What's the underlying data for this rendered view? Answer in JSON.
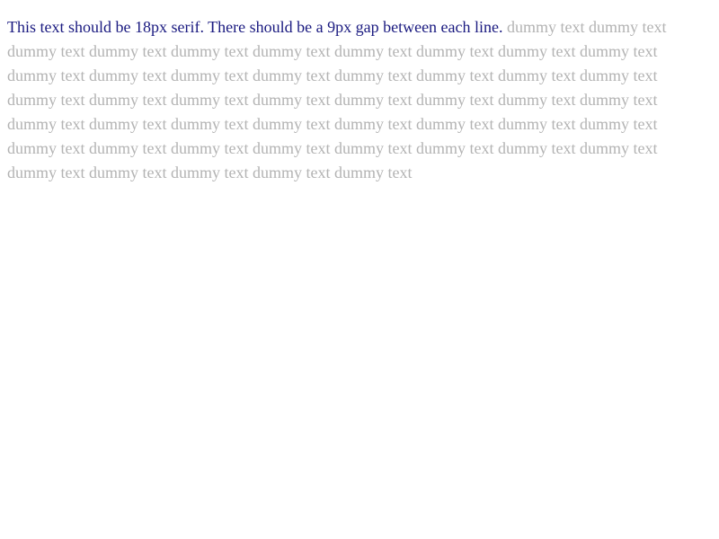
{
  "instruction_text": "This text should be 18px serif. There should be a 9px gap between each line.",
  "filler_text": "dummy text dummy text dummy text dummy text dummy text dummy text dummy text dummy text dummy text dummy text dummy text dummy text dummy text dummy text dummy text dummy text dummy text dummy text dummy text dummy text dummy text dummy text dummy text dummy text dummy text dummy text dummy text dummy text dummy text dummy text dummy text dummy text dummy text dummy text dummy text dummy text dummy text dummy text dummy text dummy text dummy text dummy text dummy text dummy text dummy text dummy text dummy text",
  "colors": {
    "instruction": "#1a1a80",
    "filler": "#b3b3b3",
    "background": "#ffffff"
  }
}
